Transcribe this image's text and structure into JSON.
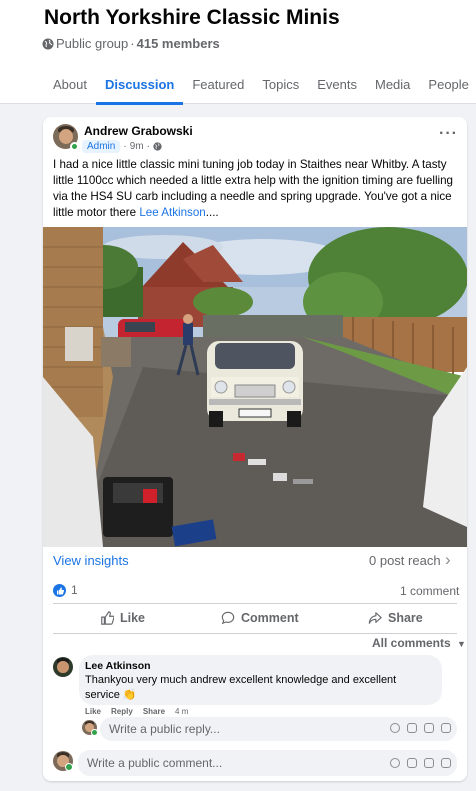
{
  "group": {
    "title": "North Yorkshire Classic Minis",
    "privacy": "Public group",
    "separator": "·",
    "members": "415 members"
  },
  "tabs": [
    {
      "label": "About",
      "active": false
    },
    {
      "label": "Discussion",
      "active": true
    },
    {
      "label": "Featured",
      "active": false
    },
    {
      "label": "Topics",
      "active": false
    },
    {
      "label": "Events",
      "active": false
    },
    {
      "label": "Media",
      "active": false
    },
    {
      "label": "People",
      "active": false
    }
  ],
  "post": {
    "author": "Andrew Grabowski",
    "role": "Admin",
    "separator": "·",
    "time": "9m",
    "separator2": "·",
    "text": "I had a nice little classic mini tuning job today in Staithes near Whitby.  A tasty little 1100cc which needed a little extra help with the ignition timing are fuelling via the HS4 SU carb including a needle and spring upgrade.  You've got a nice little motor there ",
    "tag": "Lee Atkinson",
    "text_suffix": "....",
    "view_insights": "View insights",
    "post_reach": "0 post reach",
    "like_count": "1",
    "comment_count": "1 comment"
  },
  "actions": {
    "like": "Like",
    "comment": "Comment",
    "share": "Share"
  },
  "comments": {
    "filter": "All comments",
    "items": [
      {
        "author": "Lee Atkinson",
        "text": "Thankyou very much andrew excellent knowledge and excellent service",
        "emoji": "👏",
        "like": "Like",
        "reply": "Reply",
        "share": "Share",
        "time": "4 m"
      }
    ],
    "reply_placeholder": "Write a public reply...",
    "comment_placeholder": "Write a public comment..."
  },
  "colors": {
    "accent": "#1b74e4",
    "secondary_text": "#65676b",
    "background": "#f0f2f5",
    "online": "#31a24c"
  }
}
